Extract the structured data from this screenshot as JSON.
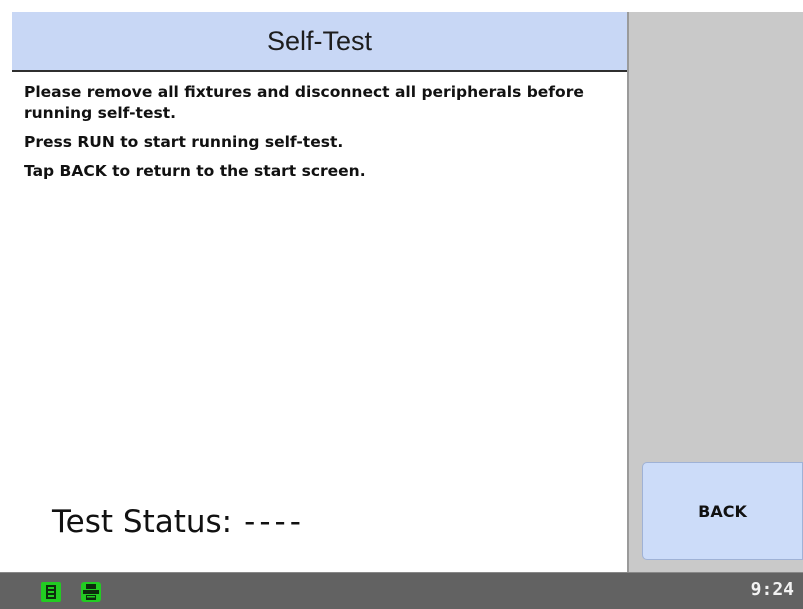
{
  "header": {
    "title": "Self-Test"
  },
  "instructions": [
    "Please remove all fixtures and disconnect all peripherals before running self-test.",
    "Press RUN to start running self-test.",
    "Tap BACK to return to the start screen."
  ],
  "status": {
    "label": "Test Status:",
    "value": "----"
  },
  "sidebar": {
    "back_label": "BACK"
  },
  "status_bar": {
    "time": "9:24",
    "icons": [
      "document-icon",
      "printer-icon"
    ],
    "icon_color": "#22cc22"
  },
  "colors": {
    "header_bg": "#c8d7f5",
    "button_bg": "#ccdcf9",
    "sidebar_bg": "#c9c9c9",
    "status_bar_bg": "#626262"
  }
}
